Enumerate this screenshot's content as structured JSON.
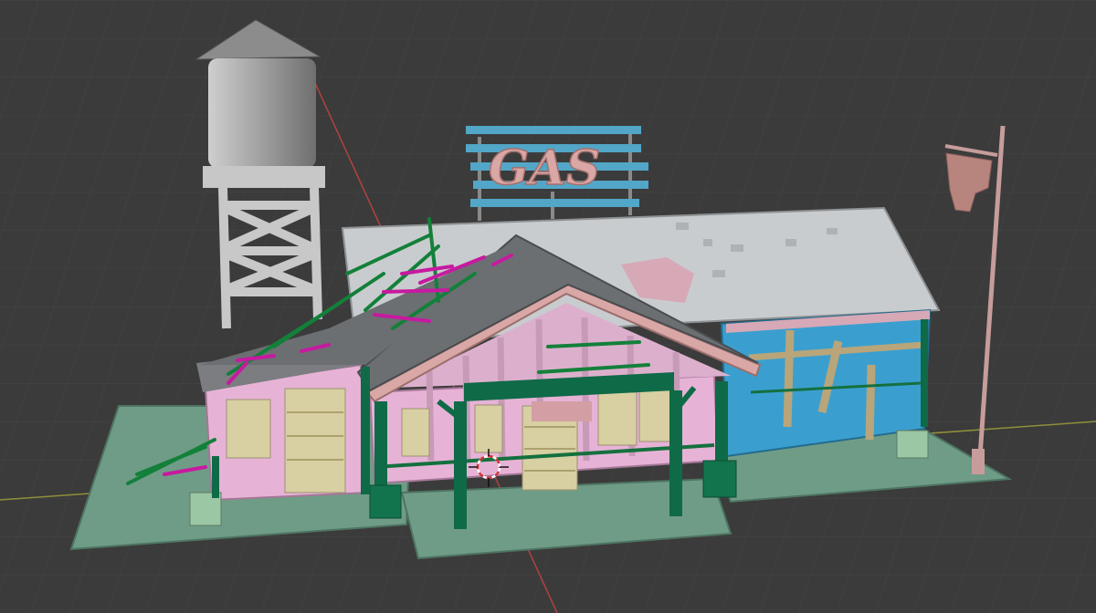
{
  "app": "3D viewport",
  "colors": {
    "background": "#3b3b3b",
    "grid": "#4a4a4a",
    "x_axis": "#8f8f3a",
    "y_axis": "#b04242",
    "wall_pink": "#e6b3d6",
    "wall_blue": "#3a9fcf",
    "trim_green": "#0f6a47",
    "roof_gray": "#c9ccce",
    "base_green": "#6f9c86",
    "sign_bar": "#52a6c7",
    "sign_letters": "#d9a7a5",
    "tank_gray": "#a7a7a7"
  },
  "sign": {
    "text": "GAS"
  },
  "icons": [
    "3d-cursor-icon"
  ]
}
